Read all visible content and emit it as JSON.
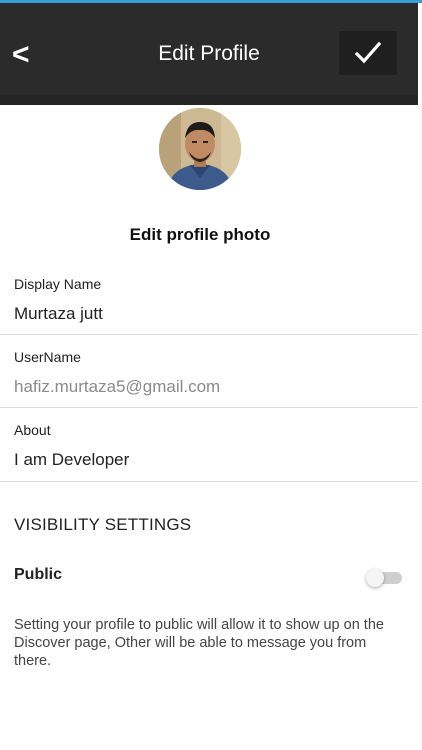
{
  "header": {
    "back_symbol": "<",
    "title": "Edit Profile",
    "save_icon": "check-icon"
  },
  "profile": {
    "avatar_icon": "profile-photo",
    "edit_photo_label": "Edit profile photo"
  },
  "fields": {
    "display_name": {
      "label": "Display Name",
      "value": "Murtaza jutt"
    },
    "username": {
      "label": "UserName",
      "value": "hafiz.murtaza5@gmail.com"
    },
    "about": {
      "label": "About",
      "value": "I am Developer"
    }
  },
  "visibility": {
    "section_title": "VISIBILITY SETTINGS",
    "public_label": "Public",
    "public_enabled": false,
    "description": "Setting your profile to public will allow it to show up on the Discover page, Other will be able to message you from there."
  },
  "colors": {
    "appbar": "#2b2b2b",
    "accent_line": "#3a9fd8"
  }
}
